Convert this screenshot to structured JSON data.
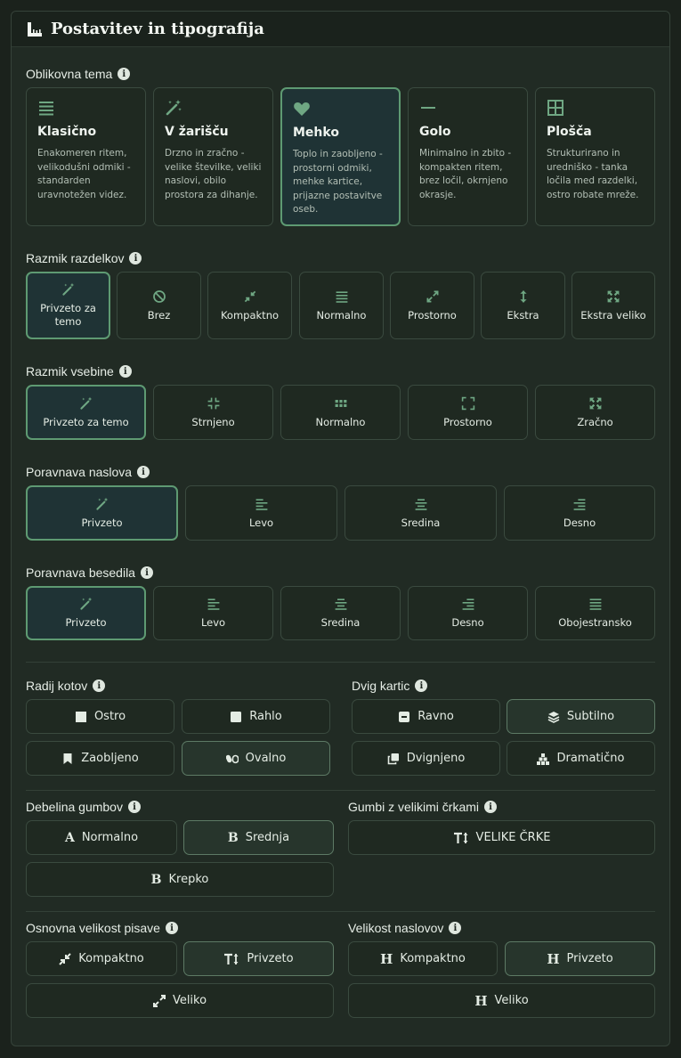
{
  "header": {
    "title": "Postavitev in tipografija",
    "icon": "ruler-icon"
  },
  "theme": {
    "label": "Oblikovna tema",
    "options": [
      {
        "name": "Klasično",
        "icon": "lines-icon",
        "desc": "Enakomeren ritem, velikodušni odmiki - standarden uravnotežen videz."
      },
      {
        "name": "V žarišču",
        "icon": "magic-wand-icon",
        "desc": "Drzno in zračno - velike številke, veliki naslovi, obilo prostora za dihanje."
      },
      {
        "name": "Mehko",
        "icon": "heart-icon",
        "desc": "Toplo in zaobljeno - prostorni odmiki, mehke kartice, prijazne postavitve oseb.",
        "selected": true
      },
      {
        "name": "Golo",
        "icon": "minus-icon",
        "desc": "Minimalno in zbito - kompakten ritem, brez ločil, okrnjeno okrasje."
      },
      {
        "name": "Plošča",
        "icon": "grid-icon",
        "desc": "Strukturirano in uredniško - tanka ločila med razdelki, ostro robate mreže."
      }
    ]
  },
  "section_spacing": {
    "label": "Razmik razdelkov",
    "options": [
      "Privzeto za temo",
      "Brez",
      "Kompaktno",
      "Normalno",
      "Prostorno",
      "Ekstra",
      "Ekstra veliko"
    ]
  },
  "content_spacing": {
    "label": "Razmik vsebine",
    "options": [
      "Privzeto za temo",
      "Strnjeno",
      "Normalno",
      "Prostorno",
      "Zračno"
    ]
  },
  "heading_align": {
    "label": "Poravnava naslova",
    "options": [
      "Privzeto",
      "Levo",
      "Sredina",
      "Desno"
    ]
  },
  "text_align": {
    "label": "Poravnava besedila",
    "options": [
      "Privzeto",
      "Levo",
      "Sredina",
      "Desno",
      "Obojestransko"
    ]
  },
  "corner_radius": {
    "label": "Radij kotov",
    "options": [
      "Ostro",
      "Rahlo",
      "Zaobljeno",
      "Ovalno"
    ],
    "selected": "Ovalno"
  },
  "card_lift": {
    "label": "Dvig kartic",
    "options": [
      "Ravno",
      "Subtilno",
      "Dvignjeno",
      "Dramatično"
    ],
    "selected": "Subtilno"
  },
  "button_weight": {
    "label": "Debelina gumbov",
    "options": [
      "Normalno",
      "Srednja",
      "Krepko"
    ],
    "selected": "Srednja"
  },
  "uppercase_buttons": {
    "label": "Gumbi z velikimi črkami",
    "option": "VELIKE ČRKE"
  },
  "base_font_size": {
    "label": "Osnovna velikost pisave",
    "options": [
      "Kompaktno",
      "Privzeto",
      "Veliko"
    ],
    "selected": "Privzeto"
  },
  "heading_size": {
    "label": "Velikost naslovov",
    "options": [
      "Kompaktno",
      "Privzeto",
      "Veliko"
    ],
    "selected": "Privzeto"
  },
  "colors": {
    "accent": "#6fa783",
    "selected_border": "#5e9a72",
    "selected_bg": "#1f3335"
  }
}
